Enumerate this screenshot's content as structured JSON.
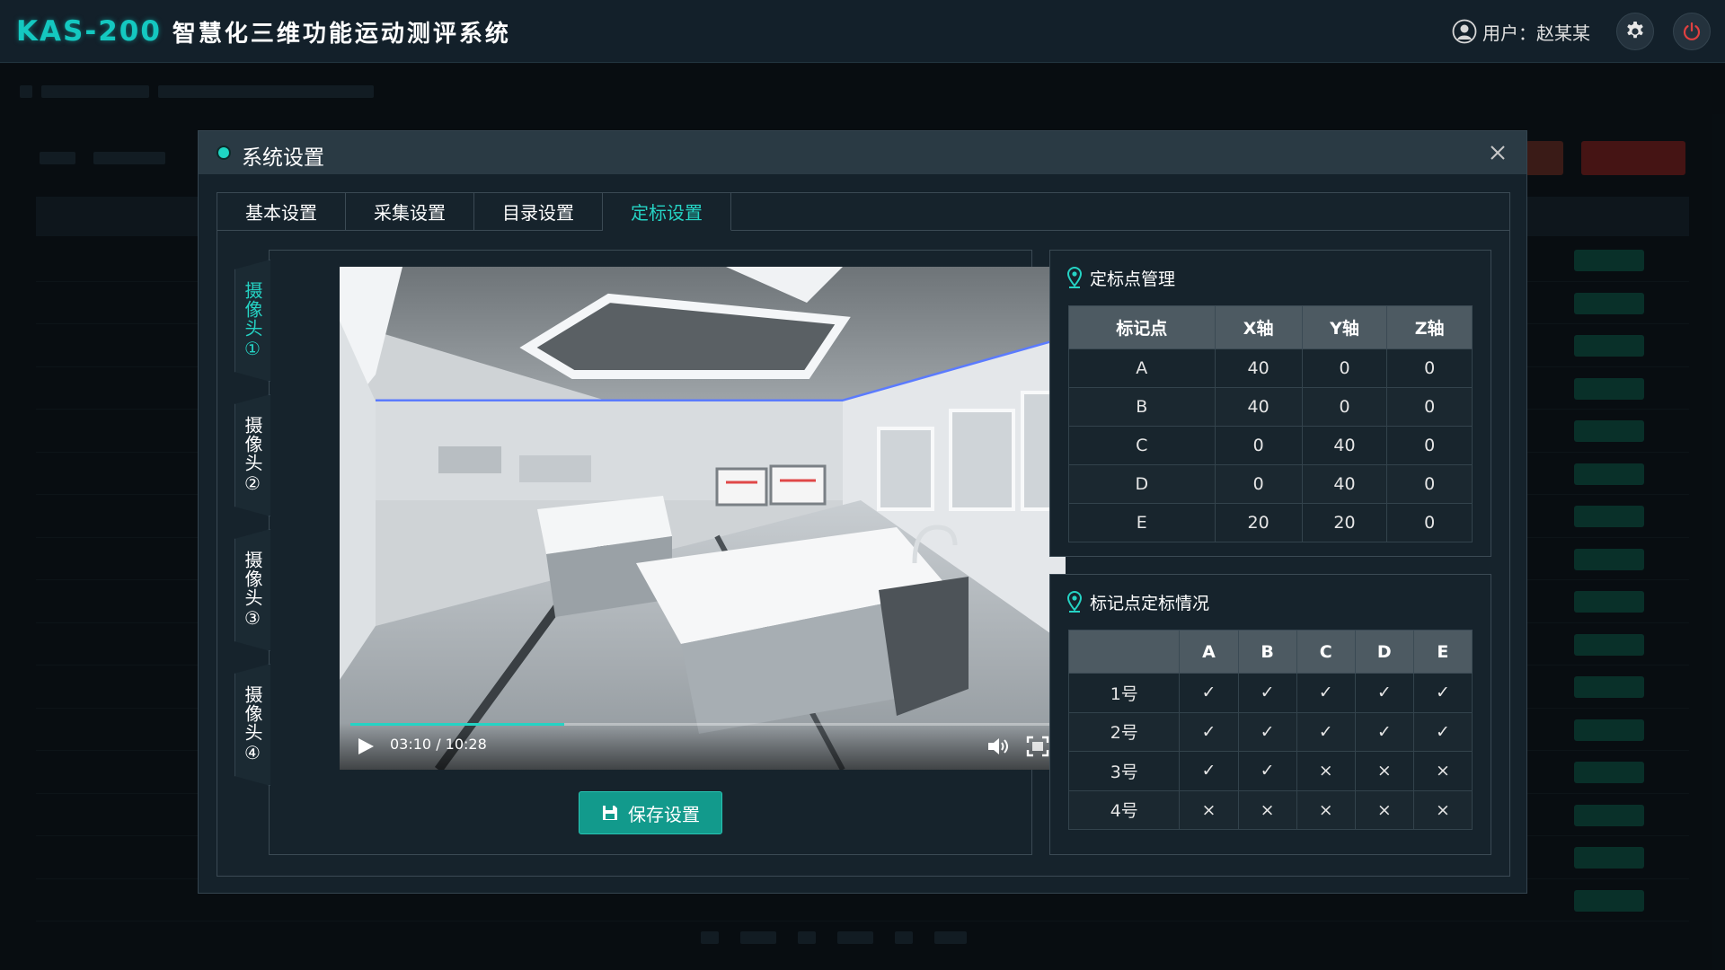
{
  "app": {
    "brand_mark": "KAS-200",
    "title": "智慧化三维功能运动测评系统",
    "user_label": "用户：赵某某"
  },
  "dialog": {
    "title": "系统设置",
    "tabs": [
      "基本设置",
      "采集设置",
      "目录设置",
      "定标设置"
    ],
    "active_tab": 3,
    "cameras": [
      "摄像头①",
      "摄像头②",
      "摄像头③",
      "摄像头④"
    ],
    "active_camera": 0,
    "video": {
      "time": "03:10 / 10:28",
      "progress": 0.303
    },
    "save_label": "保存设置",
    "calib_points": {
      "title": "定标点管理",
      "headers": [
        "标记点",
        "X轴",
        "Y轴",
        "Z轴"
      ],
      "rows": [
        [
          "A",
          "40",
          "0",
          "0"
        ],
        [
          "B",
          "40",
          "0",
          "0"
        ],
        [
          "C",
          "0",
          "40",
          "0"
        ],
        [
          "D",
          "0",
          "40",
          "0"
        ],
        [
          "E",
          "20",
          "20",
          "0"
        ]
      ]
    },
    "calib_status": {
      "title": "标记点定标情况",
      "headers": [
        "",
        "A",
        "B",
        "C",
        "D",
        "E"
      ],
      "rows": [
        {
          "label": "1号",
          "status": [
            true,
            true,
            true,
            true,
            true
          ]
        },
        {
          "label": "2号",
          "status": [
            true,
            true,
            true,
            true,
            true
          ]
        },
        {
          "label": "3号",
          "status": [
            true,
            true,
            false,
            false,
            false
          ]
        },
        {
          "label": "4号",
          "status": [
            false,
            false,
            false,
            false,
            false
          ]
        }
      ],
      "ok_symbol": "✓",
      "fail_symbol": "×"
    }
  },
  "colors": {
    "accent": "#25d3c4",
    "ok": "#2fd08a",
    "fail": "#e04848",
    "save_button": "#129a8c",
    "power_icon": "#e04040"
  },
  "icons": {
    "user": "user-icon",
    "settings": "gear-icon",
    "power": "power-icon",
    "close": "close-icon",
    "pin": "map-pin-icon",
    "play": "play-icon",
    "volume": "volume-icon",
    "fullscreen": "fullscreen-icon",
    "save": "floppy-disk-icon"
  }
}
